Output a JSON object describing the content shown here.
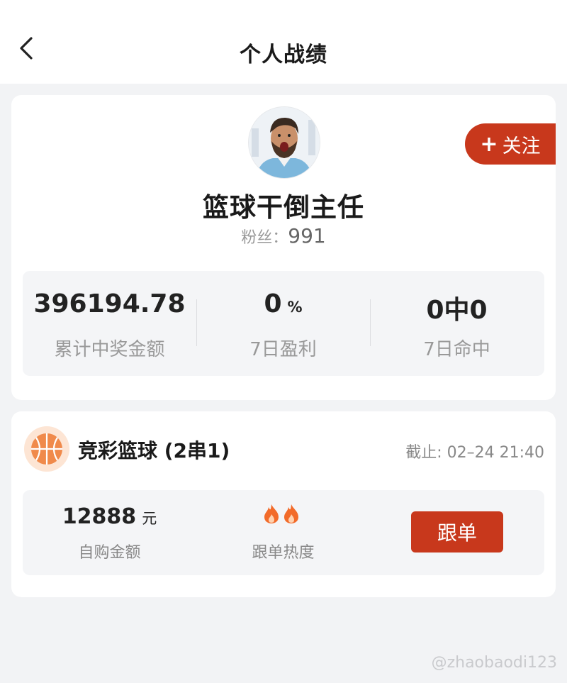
{
  "header": {
    "title": "个人战绩",
    "back_icon": "chevron-left-icon"
  },
  "profile": {
    "name": "篮球干倒主任",
    "fans_label": "粉丝：",
    "fans_count": "991",
    "follow_label": "关注",
    "follow_plus": "+"
  },
  "stats": [
    {
      "value": "396194.78",
      "unit": "",
      "label": "累计中奖金额"
    },
    {
      "value": "0",
      "unit": "%",
      "label": "7日盈利"
    },
    {
      "value": "0中0",
      "unit": "",
      "label": "7日命中"
    }
  ],
  "order": {
    "sport_title": "竞彩篮球 (2串1)",
    "deadline": "截止: 02–24 21:40",
    "amount": "12888",
    "currency": "元",
    "amount_label": "自购金额",
    "heat_label": "跟单热度",
    "heat_level": 2,
    "follow_button": "跟单"
  },
  "watermark": "@zhaobaodi123",
  "colors": {
    "accent": "#c8381c",
    "background": "#f2f3f5",
    "basketball": "#f08a4b",
    "flame": "#f26b2a"
  }
}
